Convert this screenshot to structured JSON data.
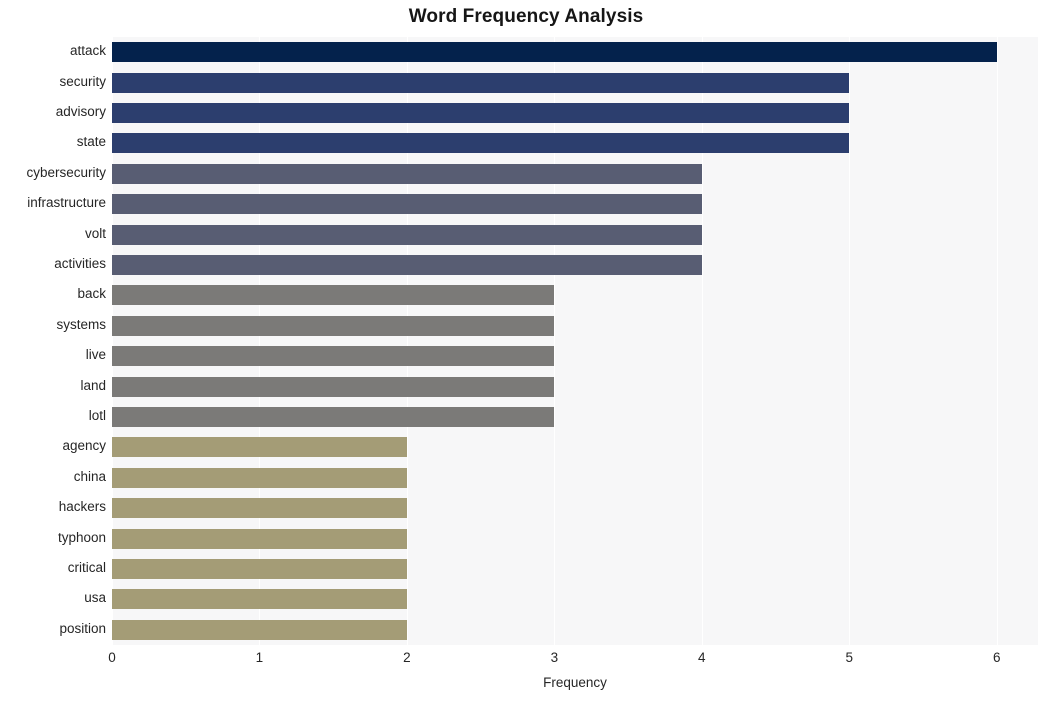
{
  "chart_data": {
    "type": "bar",
    "orientation": "horizontal",
    "title": "Word Frequency Analysis",
    "xlabel": "Frequency",
    "ylabel": "",
    "xlim": [
      0,
      6.28
    ],
    "xticks": [
      "0",
      "1",
      "2",
      "3",
      "4",
      "5",
      "6"
    ],
    "xtick_values": [
      0,
      1,
      2,
      3,
      4,
      5,
      6
    ],
    "grid": "vertical-white-gridlines",
    "legend": "none",
    "plot_background": "#f7f7f8",
    "figure_background": "#ffffff",
    "categories": [
      "attack",
      "security",
      "advisory",
      "state",
      "cybersecurity",
      "infrastructure",
      "volt",
      "activities",
      "back",
      "systems",
      "live",
      "land",
      "lotl",
      "agency",
      "china",
      "hackers",
      "typhoon",
      "critical",
      "usa",
      "position"
    ],
    "values": [
      6,
      5,
      5,
      5,
      4,
      4,
      4,
      4,
      3,
      3,
      3,
      3,
      3,
      2,
      2,
      2,
      2,
      2,
      2,
      2
    ],
    "bar_colors": [
      "#04224c",
      "#2c3e6e",
      "#2c3e6e",
      "#2c3e6e",
      "#585d73",
      "#585d73",
      "#585d73",
      "#585d73",
      "#7b7a78",
      "#7b7a78",
      "#7b7a78",
      "#7b7a78",
      "#7b7a78",
      "#a49c76",
      "#a49c76",
      "#a49c76",
      "#a49c76",
      "#a49c76",
      "#a49c76",
      "#a49c76"
    ],
    "palette": {
      "tier_6": "#04224c",
      "tier_5": "#2c3e6e",
      "tier_4": "#585d73",
      "tier_3": "#7b7a78",
      "tier_2": "#a49c76"
    }
  }
}
